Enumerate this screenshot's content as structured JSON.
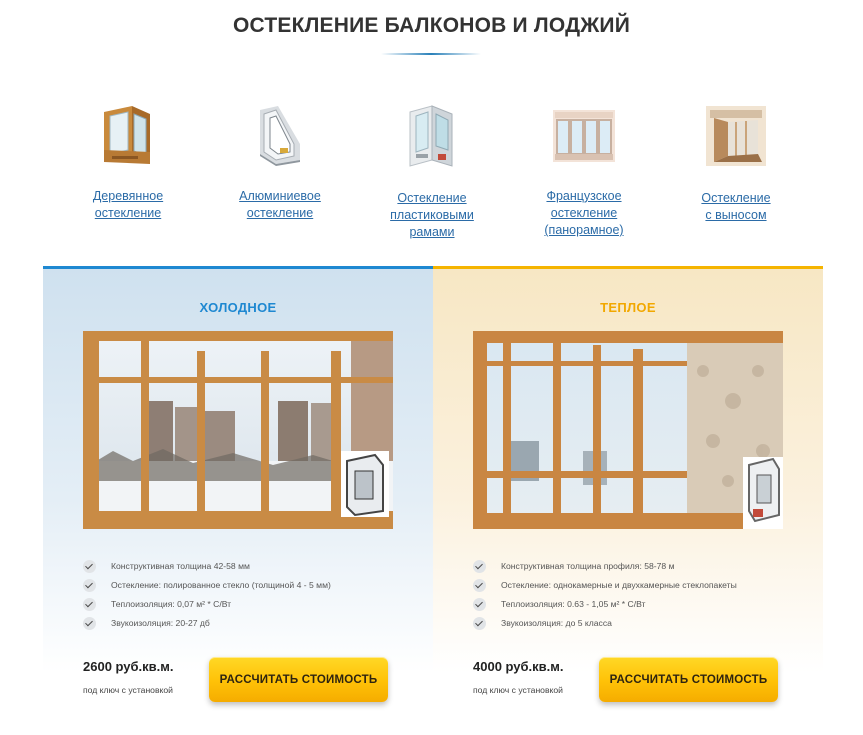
{
  "page": {
    "title": "ОСТЕКЛЕНИЕ БАЛКОНОВ И ЛОДЖИЙ"
  },
  "glazing_types": [
    {
      "icon": "wooden-window-profile-icon",
      "line1": "Деревянное",
      "line2": "остекление",
      "line3": ""
    },
    {
      "icon": "aluminum-window-profile-icon",
      "line1": "Алюминиевое",
      "line2": "остекление",
      "line3": ""
    },
    {
      "icon": "plastic-window-profile-icon",
      "line1": "Остекление",
      "line2": "пластиковыми",
      "line3": "рамами"
    },
    {
      "icon": "panoramic-balcony-icon",
      "line1": "Французское",
      "line2": "остекление",
      "line3": "(панорамное)"
    },
    {
      "icon": "extended-balcony-icon",
      "line1": "Остекление",
      "line2": "с выносом",
      "line3": ""
    }
  ],
  "panels": {
    "cold": {
      "heading": "ХОЛОДНОЕ",
      "accent": "#1e88d1",
      "photo": "cold-balcony-photo",
      "features": [
        "Конструктивная толщина 42-58 мм",
        "Остекление: полированное стекло (толщиной 4 - 5 мм)",
        "Теплоизоляция: 0,07 м² * С/Вт",
        "Звукоизоляция: 20-27 дб"
      ],
      "price": "2600 руб.кв.м.",
      "price_note": "под ключ с установкой",
      "button": "РАССЧИТАТЬ СТОИМОСТЬ"
    },
    "warm": {
      "heading": "ТЕПЛОЕ",
      "accent": "#f5b400",
      "photo": "warm-balcony-photo",
      "features": [
        "Конструктивная толщина профиля: 58-78 м",
        "Остекление: однокамерные и двухкамерные стеклопакеты",
        "Теплоизоляция: 0.63 - 1,05 м² * С/Вт",
        "Звукоизоляция: до 5 класса"
      ],
      "price": "4000 руб.кв.м.",
      "price_note": "под ключ с установкой",
      "button": "РАССЧИТАТЬ СТОИМОСТЬ"
    }
  },
  "colors": {
    "link": "#2b6ba7",
    "button": "#ffc107"
  }
}
